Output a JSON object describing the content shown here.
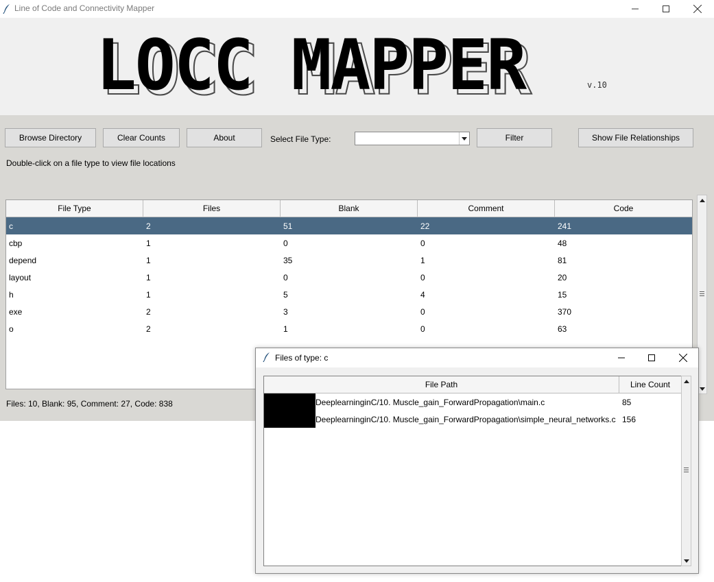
{
  "window": {
    "title": "Line of Code and Connectivity Mapper"
  },
  "banner": {
    "logo_text": "LOCC MAPPER",
    "version": "v.10"
  },
  "toolbar": {
    "browse_label": "Browse Directory",
    "clear_label": "Clear Counts",
    "about_label": "About",
    "select_label": "Select File Type:",
    "select_value": "",
    "filter_label": "Filter",
    "relationships_label": "Show File Relationships"
  },
  "hint": "Double-click on a file type to view file locations",
  "table": {
    "columns": [
      "File Type",
      "Files",
      "Blank",
      "Comment",
      "Code"
    ],
    "rows": [
      [
        "c",
        "2",
        "51",
        "22",
        "241"
      ],
      [
        "cbp",
        "1",
        "0",
        "0",
        "48"
      ],
      [
        "depend",
        "1",
        "35",
        "1",
        "81"
      ],
      [
        "layout",
        "1",
        "0",
        "0",
        "20"
      ],
      [
        "h",
        "1",
        "5",
        "4",
        "15"
      ],
      [
        "exe",
        "2",
        "3",
        "0",
        "370"
      ],
      [
        "o",
        "2",
        "1",
        "0",
        "63"
      ]
    ],
    "selected_index": 0
  },
  "summary": "Files: 10, Blank: 95, Comment: 27, Code: 838",
  "popup": {
    "title": "Files of type: c",
    "columns": [
      "File Path",
      "Line Count"
    ],
    "rows": [
      {
        "path": "DeeplearninginC/10. Muscle_gain_ForwardPropagation\\main.c",
        "count": "85"
      },
      {
        "path": "DeeplearninginC/10. Muscle_gain_ForwardPropagation\\simple_neural_networks.c",
        "count": "156"
      }
    ]
  },
  "colors": {
    "selected_row": "#4a6984",
    "toolbar_bg": "#d9d8d4"
  }
}
